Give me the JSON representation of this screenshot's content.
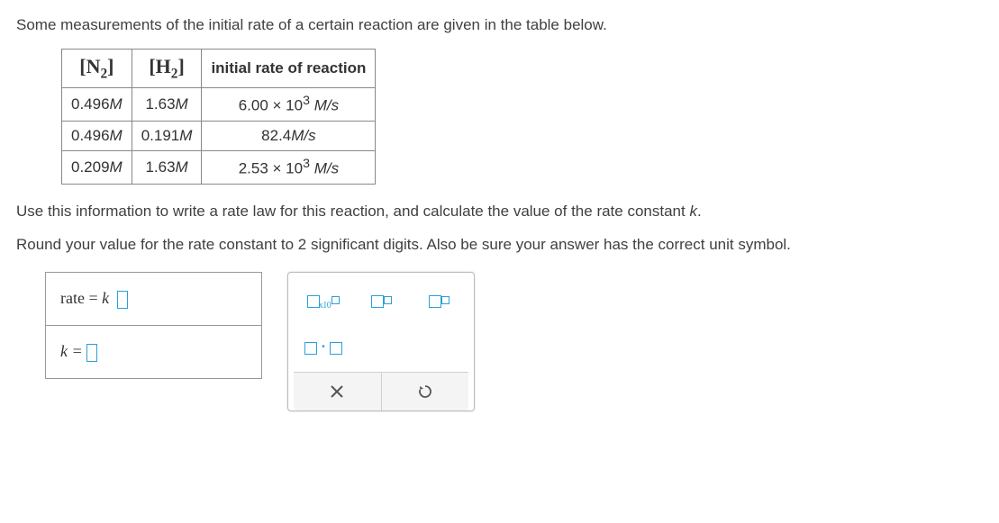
{
  "intro": "Some measurements of the initial rate of a certain reaction are given in the table below.",
  "table": {
    "headers": {
      "col1_sym": "N",
      "col1_sub": "2",
      "col2_sym": "H",
      "col2_sub": "2",
      "col3": "initial rate of reaction"
    },
    "rows": [
      {
        "n2": "0.496",
        "n2u": "M",
        "h2": "1.63",
        "h2u": "M",
        "rate_pre": "6.00 × 10",
        "rate_exp": "3",
        "rate_unit": " M/s"
      },
      {
        "n2": "0.496",
        "n2u": "M",
        "h2": "0.191",
        "h2u": "M",
        "rate_plain": "82.4",
        "rate_unit_plain": "M/s"
      },
      {
        "n2": "0.209",
        "n2u": "M",
        "h2": "1.63",
        "h2u": "M",
        "rate_pre": "2.53 × 10",
        "rate_exp": "3",
        "rate_unit": " M/s"
      }
    ]
  },
  "instr1": "Use this information to write a rate law for this reaction, and calculate the value of the rate constant ",
  "instr1_k": "k",
  "instr1_end": ".",
  "instr2": "Round your value for the rate constant to 2 significant digits. Also be sure your answer has the correct unit symbol.",
  "answers": {
    "rate_label_pre": "rate = ",
    "rate_label_k": "k",
    "k_label": "k = "
  },
  "palette": {
    "x10_label": "x10",
    "clear_title": "Clear",
    "reset_title": "Reset"
  }
}
